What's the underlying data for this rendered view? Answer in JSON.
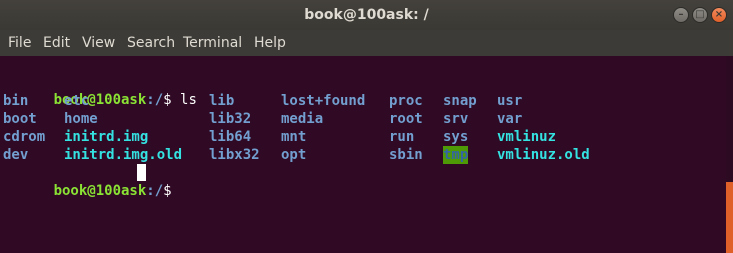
{
  "window": {
    "title": "book@100ask: /",
    "minimize_glyph": "–",
    "maximize_glyph": "□",
    "close_glyph": "×"
  },
  "menu": [
    "File",
    "Edit",
    "View",
    "Search",
    "Terminal",
    "Help"
  ],
  "terminal": {
    "prompt_user": "book@100ask",
    "prompt_path": ":/",
    "prompt_symbol": "$ ",
    "command": "ls",
    "listing": [
      [
        "bin",
        "etc",
        "lib",
        "lost+found",
        "proc",
        "snap",
        "usr"
      ],
      [
        "boot",
        "home",
        "lib32",
        "media",
        "root",
        "srv",
        "var"
      ],
      [
        "cdrom",
        "initrd.img",
        "lib64",
        "mnt",
        "run",
        "sys",
        "vmlinuz"
      ],
      [
        "dev",
        "initrd.img.old",
        "libx32",
        "opt",
        "sbin",
        "tmp",
        "vmlinuz.old"
      ]
    ]
  },
  "colors": {
    "background": "#300a24",
    "prompt_user": "#8ae234",
    "directory": "#729fcf",
    "symlink": "#34e2e2",
    "sticky_dir_bg": "#4e9a06",
    "scroll_accent": "#e0602a"
  }
}
